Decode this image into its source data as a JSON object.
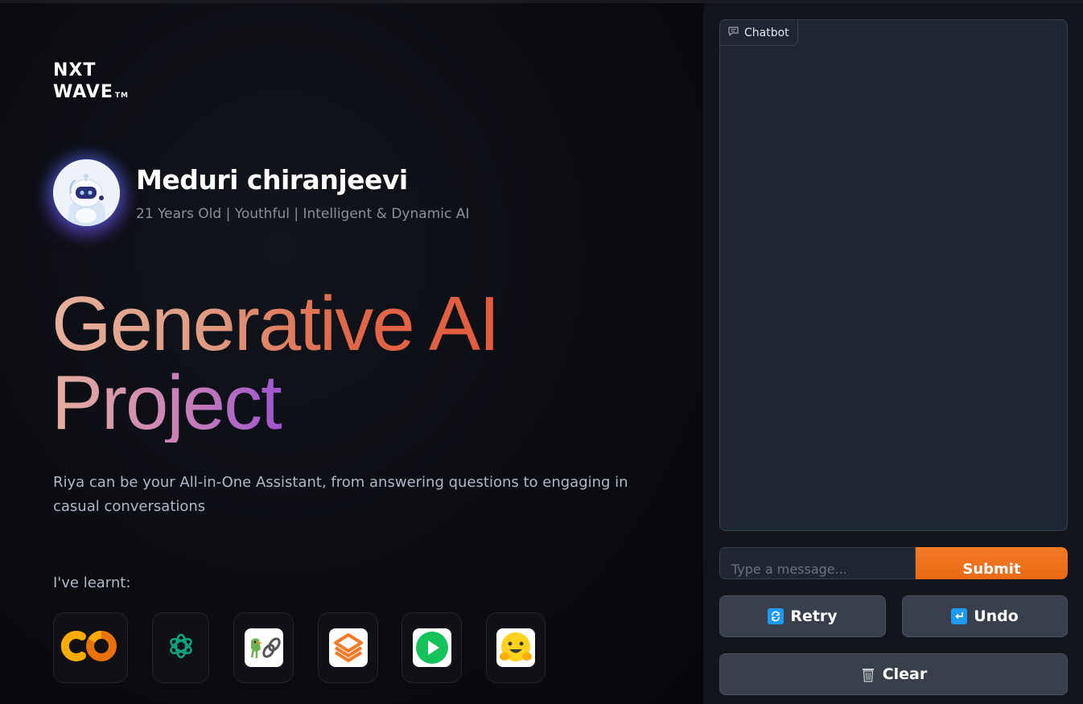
{
  "brand": {
    "line1": "NXT",
    "line2": "WAVE",
    "trademark": "TM"
  },
  "profile": {
    "name": "Meduri chiranjeevi",
    "tagline": "21 Years Old | Youthful | Intelligent & Dynamic AI",
    "avatar_icon": "robot-avatar-icon"
  },
  "hero": {
    "line1": "Generative AI",
    "line2": "Project"
  },
  "description": "Riya can be your All-in-One Assistant, from answering questions to engaging in casual conversations",
  "learnt_label": "I've learnt:",
  "tools": [
    {
      "icon": "google-colab-icon"
    },
    {
      "icon": "openai-icon"
    },
    {
      "icon": "langchain-icon"
    },
    {
      "icon": "layered-stack-icon"
    },
    {
      "icon": "play-icon"
    },
    {
      "icon": "hugging-face-icon"
    }
  ],
  "chat": {
    "label": "Chatbot",
    "input_placeholder": "Type a message...",
    "submit_label": "Submit",
    "retry_label": "Retry",
    "undo_label": "Undo",
    "clear_label": "Clear"
  },
  "colors": {
    "accent": "#ea6a12",
    "background": "#0b0d12",
    "panel": "#1f2633",
    "button": "#3a404b"
  }
}
